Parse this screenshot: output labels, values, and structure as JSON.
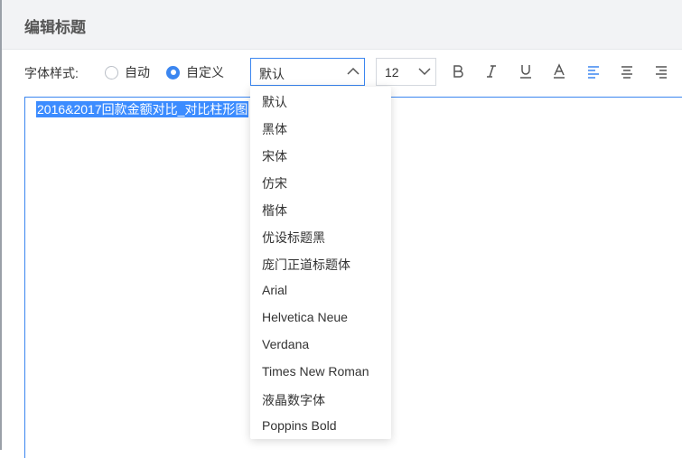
{
  "dialog": {
    "title": "编辑标题"
  },
  "toolbar": {
    "font_style_label": "字体样式:",
    "radio_auto": "自动",
    "radio_custom": "自定义",
    "radio_selected": "自定义",
    "font_select_value": "默认",
    "size_select_value": "12",
    "active_align": "left"
  },
  "editor": {
    "text": "2016&2017回款金额对比_对比柱形图"
  },
  "font_dropdown": {
    "expanded": true,
    "options": [
      "默认",
      "黑体",
      "宋体",
      "仿宋",
      "楷体",
      "优设标题黑",
      "庞门正道标题体",
      "Arial",
      "Helvetica Neue",
      "Verdana",
      "Times New Roman",
      "液晶数字体",
      "Poppins Bold"
    ]
  },
  "colors": {
    "accent": "#3b86f0",
    "selection": "#3c8cff",
    "header_bg": "#f2f3f5"
  },
  "icons": [
    "chevron-up-icon",
    "chevron-down-icon",
    "bold-icon",
    "italic-icon",
    "underline-icon",
    "font-color-icon",
    "align-left-icon",
    "align-center-icon",
    "align-right-icon"
  ]
}
